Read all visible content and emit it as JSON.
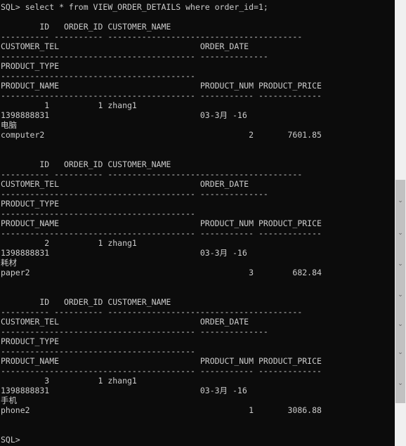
{
  "console": {
    "lines": [
      "SQL> select * from VIEW_ORDER_DETAILS where order_id=1;",
      "",
      "        ID   ORDER_ID CUSTOMER_NAME",
      "---------- ---------- ----------------------------------------",
      "CUSTOMER_TEL                             ORDER_DATE",
      "---------------------------------------- --------------",
      "PRODUCT_TYPE",
      "----------------------------------------",
      "PRODUCT_NAME                             PRODUCT_NUM PRODUCT_PRICE",
      "---------------------------------------- ----------- -------------",
      "         1          1 zhang1",
      "1398888831                               03-3月 -16",
      "电脑",
      "computer2                                          2       7601.85",
      "",
      "",
      "        ID   ORDER_ID CUSTOMER_NAME",
      "---------- ---------- ----------------------------------------",
      "CUSTOMER_TEL                             ORDER_DATE",
      "---------------------------------------- --------------",
      "PRODUCT_TYPE",
      "----------------------------------------",
      "PRODUCT_NAME                             PRODUCT_NUM PRODUCT_PRICE",
      "---------------------------------------- ----------- -------------",
      "         2          1 zhang1",
      "1398888831                               03-3月 -16",
      "耗材",
      "paper2                                             3        682.84",
      "",
      "",
      "        ID   ORDER_ID CUSTOMER_NAME",
      "---------- ---------- ----------------------------------------",
      "CUSTOMER_TEL                             ORDER_DATE",
      "---------------------------------------- --------------",
      "PRODUCT_TYPE",
      "----------------------------------------",
      "PRODUCT_NAME                             PRODUCT_NUM PRODUCT_PRICE",
      "---------------------------------------- ----------- -------------",
      "         3          1 zhang1",
      "1398888831                               03-3月 -16",
      "手机",
      "phone2                                             1       3086.88",
      "",
      "",
      "SQL>"
    ]
  },
  "scrollbar": {
    "thumb_color": "#c1c1c1",
    "track_color": "#f0f0f0",
    "arrow_glyph": "⌄"
  },
  "colors": {
    "background": "#0c0c0c",
    "text": "#cccccc"
  }
}
